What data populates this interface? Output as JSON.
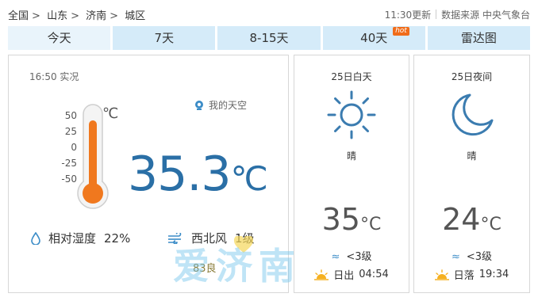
{
  "breadcrumb": [
    "全国",
    "山东",
    "济南",
    "城区"
  ],
  "breadcrumb_sep": ">",
  "meta": {
    "updated": "11:30更新",
    "source": "数据来源 中央气象台"
  },
  "tabs": [
    {
      "label": "今天",
      "active": true
    },
    {
      "label": "7天"
    },
    {
      "label": "8-15天"
    },
    {
      "label": "40天",
      "badge": "hot"
    },
    {
      "label": "雷达图"
    }
  ],
  "now": {
    "time_label": "16:50 实况",
    "my_sky": "我的天空",
    "scale": [
      "50",
      "25",
      "0",
      "-25",
      "-50"
    ],
    "scale_unit": "℃",
    "temperature": "35.3",
    "temp_unit": "℃",
    "humidity_label": "相对湿度",
    "humidity_value": "22%",
    "wind_dir": "西北风",
    "wind_level": "1级",
    "aqi": "83良"
  },
  "watermark": "爱济南",
  "day": {
    "title": "25日白天",
    "icon": "sun-icon",
    "desc": "晴",
    "temp": "35",
    "unit": "°C",
    "wind": "<3级",
    "sun_label": "日出",
    "sun_time": "04:54"
  },
  "night": {
    "title": "25日夜间",
    "icon": "moon-icon",
    "desc": "晴",
    "temp": "24",
    "unit": "°C",
    "wind": "<3级",
    "sun_label": "日落",
    "sun_time": "19:34"
  },
  "colors": {
    "accent": "#2a6fa6",
    "tab_bg": "#d5ebf9",
    "thermo_fill": "#f0781e",
    "icon": "#3b7cb0"
  }
}
